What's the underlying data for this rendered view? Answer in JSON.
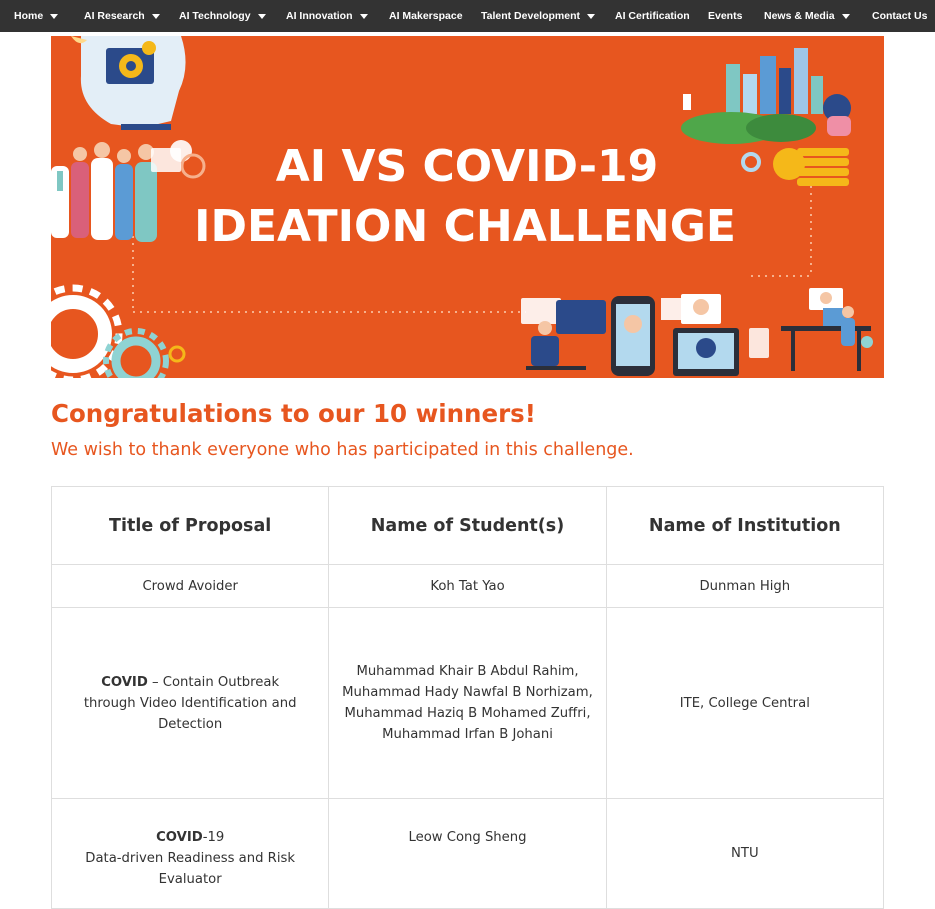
{
  "nav": {
    "items": [
      {
        "label": "Home",
        "dropdown": true
      },
      {
        "label": "AI Research",
        "dropdown": true
      },
      {
        "label": "AI Technology",
        "dropdown": true
      },
      {
        "label": "AI Innovation",
        "dropdown": true
      },
      {
        "label": "AI Makerspace",
        "dropdown": false
      },
      {
        "label": "Talent Development",
        "dropdown": true
      },
      {
        "label": "AI Certification",
        "dropdown": false
      },
      {
        "label": "Events",
        "dropdown": false
      },
      {
        "label": "News & Media",
        "dropdown": true
      },
      {
        "label": "Contact Us",
        "dropdown": false
      }
    ]
  },
  "banner": {
    "title_line1": "AI VS COVID-19",
    "title_line2": "IDEATION CHALLENGE",
    "background_color": "#e7561f",
    "icon_names": [
      "head-gear-icon",
      "medical-staff-illustration",
      "city-skyline-illustration",
      "coins-icon",
      "gears-icon",
      "video-call-illustration",
      "workstation-illustration"
    ]
  },
  "content": {
    "congrats": "Congratulations to our 10 winners!",
    "thanks": "We wish to thank everyone who has participated in this challenge."
  },
  "table": {
    "headers": [
      "Title of Proposal",
      "Name of Student(s)",
      "Name of Institution"
    ],
    "rows": [
      {
        "title_bold": "",
        "title_rest": "Crowd Avoider",
        "title_line2": "",
        "students": [
          "Koh Tat Yao"
        ],
        "institution": "Dunman High"
      },
      {
        "title_bold": "COVID",
        "title_rest": " – Contain Outbreak",
        "title_line2": "through Video Identification and Detection",
        "students": [
          "Muhammad Khair B Abdul Rahim,",
          "Muhammad Hady Nawfal B Norhizam,",
          "Muhammad Haziq B Mohamed Zuffri,",
          "Muhammad Irfan B Johani"
        ],
        "institution": "ITE, College Central"
      },
      {
        "title_bold": "COVID",
        "title_rest": "-19",
        "title_line2": "Data-driven Readiness and Risk Evaluator",
        "students": [
          "Leow Cong Sheng"
        ],
        "institution": "NTU"
      }
    ]
  },
  "colors": {
    "accent": "#e7561f",
    "nav_bg": "#333333",
    "border": "#dedede"
  }
}
